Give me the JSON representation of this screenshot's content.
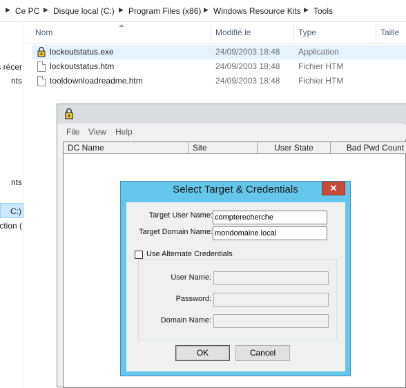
{
  "breadcrumb": {
    "items": [
      "Ce PC",
      "Disque local (C:)",
      "Program Files (x86)",
      "Windows Resource Kits",
      "Tools"
    ],
    "separator_icon": "chevron-right-icon"
  },
  "nav": {
    "items": [
      {
        "label": "s récer",
        "selected": false
      },
      {
        "label": "nts",
        "selected": false
      },
      {
        "label": "nts",
        "selected": false
      },
      {
        "label": "C:)",
        "selected": true
      },
      {
        "label": "ction (",
        "selected": false
      }
    ]
  },
  "columns": {
    "name": "Nom",
    "modified": "Modifié le",
    "type": "Type",
    "size": "Taille",
    "sort_icon": "sort-up-icon"
  },
  "files": [
    {
      "name": "lockoutstatus.exe",
      "date": "24/09/2003 18:48",
      "type": "Application",
      "icon": "lock-app-icon",
      "selected": true
    },
    {
      "name": "lockoutstatus.htm",
      "date": "24/09/2003 18:48",
      "type": "Fichier HTM",
      "icon": "document-icon",
      "selected": false
    },
    {
      "name": "tooldownloadreadme.htm",
      "date": "24/09/2003 18:48",
      "type": "Fichier HTM",
      "icon": "document-icon",
      "selected": false
    }
  ],
  "app": {
    "icon": "lock-app-icon",
    "menu": [
      "File",
      "View",
      "Help"
    ],
    "columns": [
      "DC Name",
      "Site",
      "User State",
      "Bad Pwd Count"
    ]
  },
  "dialog": {
    "title": "Select Target & Credentials",
    "close_icon": "close-icon",
    "target_user_label": "Target User Name:",
    "target_user_value": "compterecherche",
    "target_domain_label": "Target Domain Name:",
    "target_domain_value": "mondomaine.local",
    "use_alt_label": "Use Alternate Credentials",
    "use_alt_checked": false,
    "user_name_label": "User Name:",
    "password_label": "Password:",
    "domain_name_label": "Domain Name:",
    "ok_label": "OK",
    "cancel_label": "Cancel"
  },
  "colors": {
    "dialog_frame": "#64c6ea",
    "close_button": "#c74b3a",
    "selection": "#e5f3ff"
  }
}
